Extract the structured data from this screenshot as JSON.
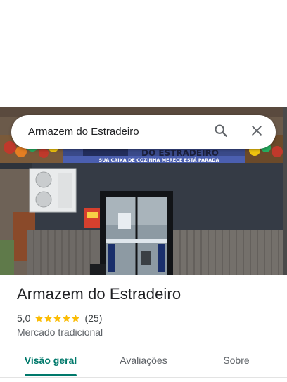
{
  "search": {
    "query": "Armazem do Estradeiro",
    "search_icon": "search-icon",
    "close_icon": "close-icon"
  },
  "photo": {
    "sign_title": "DO ESTRADEIRO",
    "sign_tagline": "SUA CAIXA DE COZINHA MERECE ESTÁ PARADA"
  },
  "place": {
    "name": "Armazem do Estradeiro",
    "rating": "5,0",
    "stars": 5,
    "review_count": "(25)",
    "category": "Mercado tradicional"
  },
  "tabs": [
    {
      "label": "Visão geral",
      "active": true
    },
    {
      "label": "Avaliações",
      "active": false
    },
    {
      "label": "Sobre",
      "active": false
    }
  ],
  "colors": {
    "accent": "#00796b",
    "star": "#fbbc04",
    "text_primary": "#202124",
    "text_secondary": "#5f6368"
  }
}
